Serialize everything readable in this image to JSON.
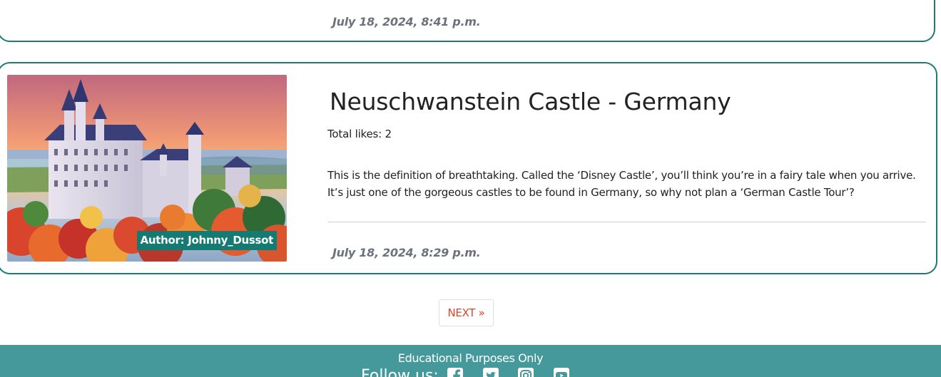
{
  "previous_post": {
    "date": "July 18, 2024, 8:41 p.m."
  },
  "post": {
    "title": "Neuschwanstein Castle - Germany",
    "likes": "Total likes: 2",
    "excerpt": "This is the definition of breathtaking. Called the ‘Disney Castle’, you’ll think you’re in a fairy tale when you arrive. It’s just one of the gorgeous castles to be found in Germany, so why not plan a ‘German Castle Tour’?",
    "author_badge": "Author: Johnny_Dussot",
    "date": "July 18, 2024, 8:29 p.m.",
    "image": "castle-photo"
  },
  "pagination": {
    "next_label": "NEXT »"
  },
  "footer": {
    "note": "Educational Purposes Only",
    "follow_label": "Follow us:",
    "social_icons": [
      "facebook-icon",
      "twitter-icon",
      "instagram-icon",
      "youtube-icon"
    ]
  },
  "colors": {
    "card_border": "#1f7a76",
    "badge_bg": "#157a72",
    "footer_bg": "#46999a",
    "next_text": "#d9472b",
    "date_text": "#6a737b"
  }
}
